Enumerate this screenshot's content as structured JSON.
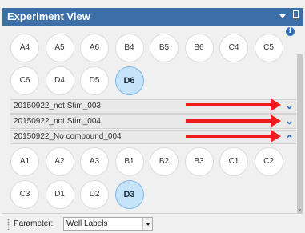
{
  "window": {
    "title": "Experiment View"
  },
  "plate_top": {
    "row1": [
      {
        "label": "A4",
        "selected": false
      },
      {
        "label": "A5",
        "selected": false
      },
      {
        "label": "A6",
        "selected": false
      },
      {
        "label": "B4",
        "selected": false
      },
      {
        "label": "B5",
        "selected": false
      },
      {
        "label": "B6",
        "selected": false
      },
      {
        "label": "C4",
        "selected": false
      },
      {
        "label": "C5",
        "selected": false
      }
    ],
    "row2": [
      {
        "label": "C6",
        "selected": false
      },
      {
        "label": "D4",
        "selected": false
      },
      {
        "label": "D5",
        "selected": false
      },
      {
        "label": "D6",
        "selected": true
      }
    ]
  },
  "groups": [
    {
      "label": "20150922_not Stim_003",
      "state": "collapsed"
    },
    {
      "label": "20150922_not Stim_004",
      "state": "collapsed"
    },
    {
      "label": "20150922_No compound_004",
      "state": "expanded"
    }
  ],
  "plate_bottom": {
    "row1": [
      {
        "label": "A1",
        "selected": false
      },
      {
        "label": "A2",
        "selected": false
      },
      {
        "label": "A3",
        "selected": false
      },
      {
        "label": "B1",
        "selected": false
      },
      {
        "label": "B2",
        "selected": false
      },
      {
        "label": "B3",
        "selected": false
      },
      {
        "label": "C1",
        "selected": false
      },
      {
        "label": "C2",
        "selected": false
      }
    ],
    "row2": [
      {
        "label": "C3",
        "selected": false
      },
      {
        "label": "D1",
        "selected": false
      },
      {
        "label": "D2",
        "selected": false
      },
      {
        "label": "D3",
        "selected": true
      }
    ]
  },
  "parameter": {
    "label": "Parameter:",
    "value": "Well Labels"
  },
  "colors": {
    "title_bar": "#3c6ea8",
    "selected_well": "#c5e3f9",
    "chevron": "#2f6eb5",
    "annotation_arrow": "#ee1c1c"
  },
  "icons": {
    "info": "info-icon",
    "collapse_panel": "chevron-up-icon",
    "pin": "pin-icon",
    "menu": "dropdown-triangle-icon"
  }
}
